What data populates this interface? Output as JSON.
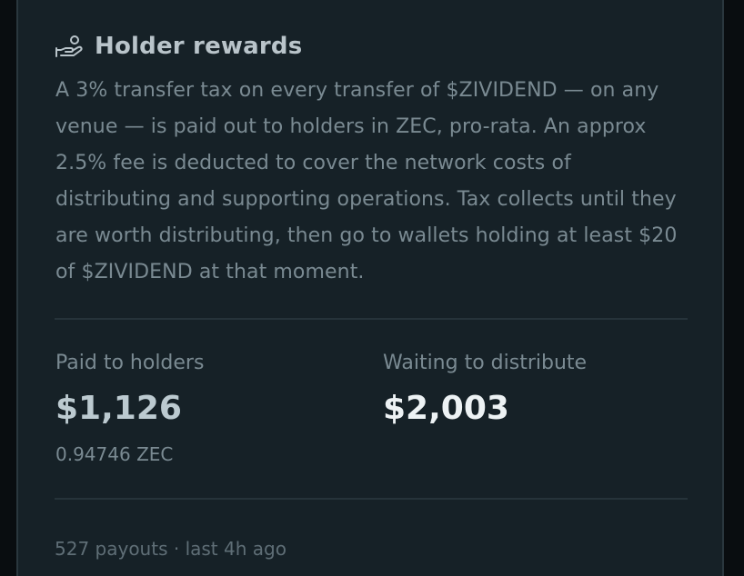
{
  "card": {
    "icon": "hand-coin-icon",
    "title": "Holder rewards",
    "description": "A 3% transfer tax on every transfer of $ZIVIDEND — on any venue — is paid out to holders in ZEC, pro-rata. An approx 2.5% fee is deducted to cover the network costs of distributing and supporting operations. Tax collects until they are worth distributing, then go to wallets holding at least $20 of $ZIVIDEND at that moment.",
    "stats": {
      "paid": {
        "label": "Paid to holders",
        "value": "$1,126",
        "sub": "0.94746 ZEC"
      },
      "waiting": {
        "label": "Waiting to distribute",
        "value": "$2,003"
      }
    },
    "footer": "527 payouts · last 4h ago"
  },
  "colors": {
    "background": "#090d10",
    "card_background": "#162127",
    "card_border": "#2a373e",
    "title": "#b9c4ca",
    "muted_text": "#7a8a92",
    "paid_value": "#bccad0",
    "waiting_value": "#edf2f4",
    "divider": "#26333a"
  }
}
